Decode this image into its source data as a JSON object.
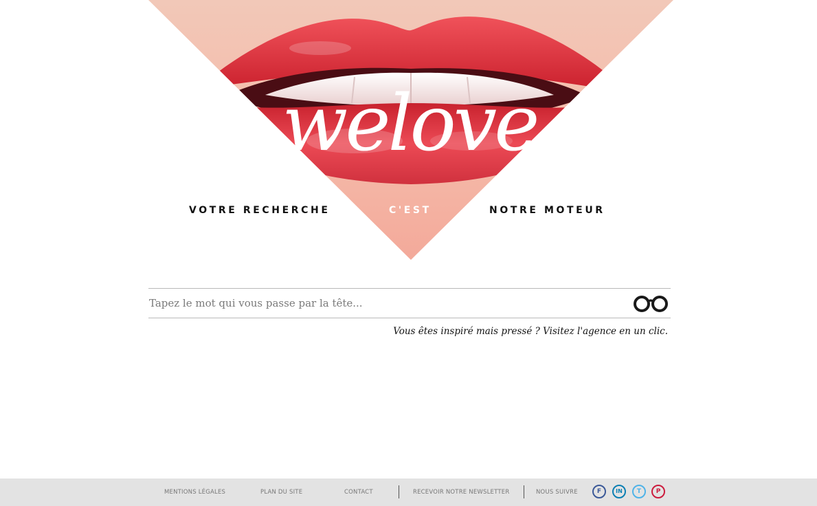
{
  "hero": {
    "logo_text": "welove",
    "image": "red-lips-photo"
  },
  "tagline": {
    "part1": "VOTRE RECHERCHE",
    "part2": "C'EST",
    "part3": "NOTRE MOTEUR"
  },
  "search": {
    "placeholder": "Tapez le mot qui vous passe par la tête...",
    "value": "",
    "button_icon": "glasses-icon"
  },
  "hint": {
    "text": "Vous êtes inspiré mais pressé ? Visitez l'agence en un clic."
  },
  "footer": {
    "links": {
      "legal": "MENTIONS LÉGALES",
      "sitemap": "PLAN DU SITE",
      "contact": "CONTACT",
      "newsletter": "RECEVOIR NOTRE NEWSLETTER",
      "follow": "NOUS SUIVRE"
    },
    "social": {
      "facebook": "F",
      "linkedin": "IN",
      "twitter": "T",
      "pinterest": "P"
    },
    "colors": {
      "facebook": "#3b5998",
      "linkedin": "#0b7fb3",
      "twitter": "#4fb3e8",
      "pinterest": "#cc1b3d"
    }
  },
  "colors": {
    "lip_red": "#e8323c",
    "skin": "#f3c0ae",
    "footer_bg": "#e3e3e3"
  }
}
